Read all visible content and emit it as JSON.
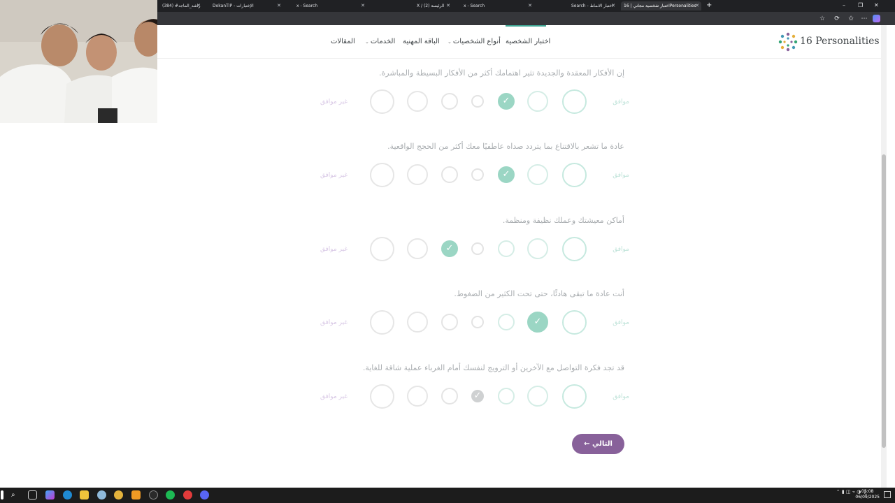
{
  "browser": {
    "tabs": [
      {
        "title": "(384) #راشد_الماجد"
      },
      {
        "title": "DokanTIP - الإختبارات"
      },
      {
        "title": "x - Search"
      },
      {
        "title": "X / (2) الرئيسة"
      },
      {
        "title": "x - Search"
      },
      {
        "title": "Search - اختبار الانماط"
      },
      {
        "title": "اختبار شخصية مجاني | 16Personalities",
        "active": true
      }
    ],
    "new_tab": "+",
    "win_minimize": "–",
    "win_restore": "❐",
    "win_close": "✕"
  },
  "site": {
    "logo_text": "16 Personalities",
    "nav": {
      "test": "اختبار الشخصية",
      "types": "أنواع الشخصيات",
      "career": "الباقة المهنية",
      "services": "الخدمات",
      "articles": "المقالات"
    }
  },
  "labels": {
    "agree": "موافق",
    "disagree": "غير موافق"
  },
  "questions": [
    {
      "text": "إن الأفكار المعقدة والجديدة تثير اهتمامك أكثر من الأفكار البسيطة والمباشرة.",
      "selected": 2
    },
    {
      "text": "عادة ما تشعر بالاقتناع بما يتردد صداه عاطفيًا معك أكثر من الحجج الواقعية.",
      "selected": 2
    },
    {
      "text": "أماكن معيشتك وعملك نظيفة ومنظمة.",
      "selected": 4
    },
    {
      "text": "أنت عادة ما تبقى هادئًا، حتى تحت الكثير من الضغوط.",
      "selected": 1
    },
    {
      "text": "قد تجد فكرة التواصل مع الآخرين أو الترويج لنفسك أمام الغرباء عملية شاقة للغاية.",
      "selected": 3
    }
  ],
  "next_button": "التالي",
  "taskbar": {
    "time": "05:08",
    "date": "06/09/2025",
    "lang": "ع"
  },
  "colors": {
    "agree_green": "#9bd6c4",
    "primary_purple": "#88619a",
    "accent_teal": "#3ea391"
  }
}
